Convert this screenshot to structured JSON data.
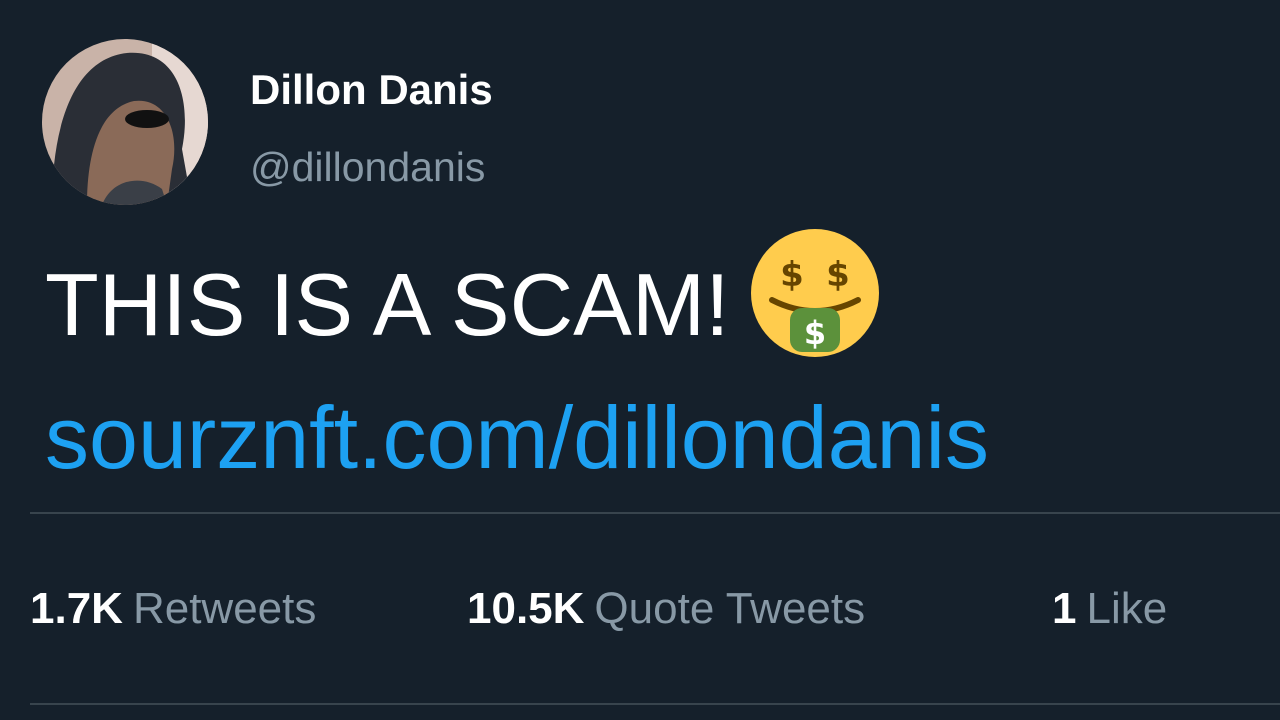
{
  "author": {
    "display_name": "Dillon Danis",
    "handle": "@dillondanis"
  },
  "tweet": {
    "text": "THIS IS A SCAM!",
    "emoji_icon": "money-mouth-face-icon",
    "link": "sourznft.com/dillondanis"
  },
  "stats": {
    "retweets": {
      "count": "1.7K",
      "label": "Retweets"
    },
    "quote_tweets": {
      "count": "10.5K",
      "label": "Quote Tweets"
    },
    "likes": {
      "count": "1",
      "label": "Like"
    }
  },
  "colors": {
    "background": "#15202b",
    "primary_text": "#ffffff",
    "secondary_text": "#8899a6",
    "link": "#1da1f2",
    "divider": "#38444d"
  }
}
